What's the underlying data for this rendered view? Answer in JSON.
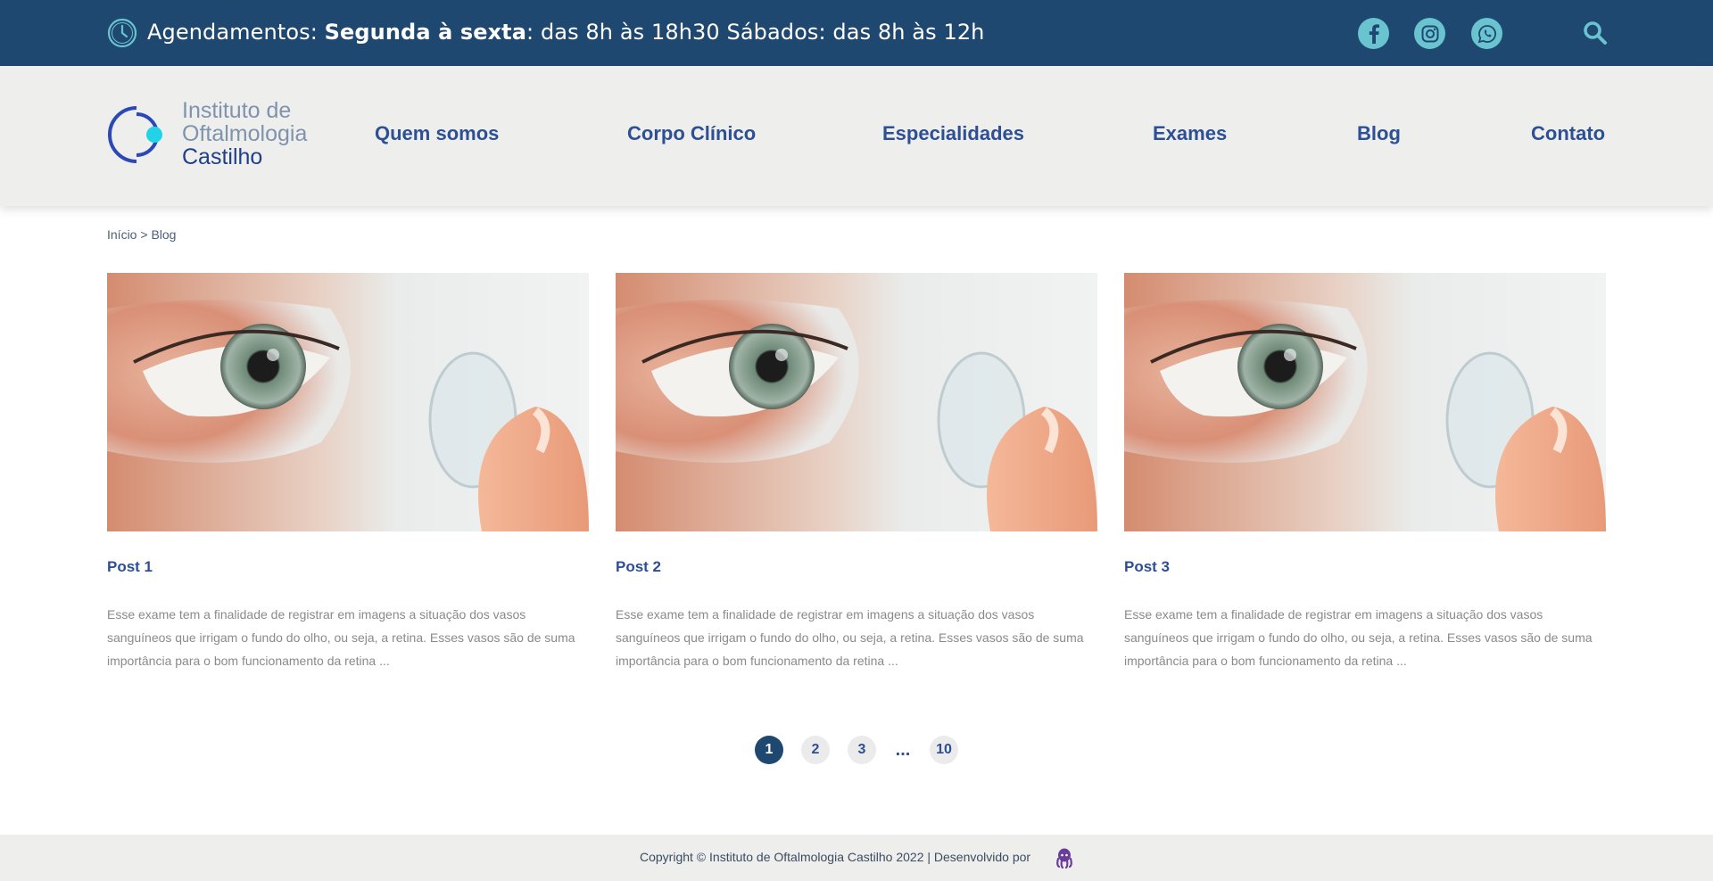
{
  "topbar": {
    "prefix": "Agendamentos: ",
    "days_bold": "Segunda à sexta",
    "hours_rest": ": das 8h às 18h30 Sábados: das 8h às 12h",
    "icons": [
      "clock-icon",
      "facebook-icon",
      "instagram-icon",
      "whatsapp-icon",
      "search-icon"
    ],
    "icon_color": "#6ac4cf",
    "bg_color": "#1f4871"
  },
  "logo": {
    "line1": "Instituto de",
    "line2": "Oftalmologia",
    "line3": "Castilho"
  },
  "nav": {
    "items": [
      "Quem somos",
      "Corpo Clínico",
      "Especialidades",
      "Exames",
      "Blog",
      "Contato"
    ],
    "color": "#2d4f96"
  },
  "breadcrumb": {
    "home": "Início",
    "sep": " > ",
    "current": "Blog"
  },
  "posts": [
    {
      "title": "Post 1",
      "excerpt": "Esse exame tem a finalidade de registrar em imagens a situação dos vasos sanguíneos que irrigam o fundo do olho, ou seja, a retina. Esses vasos são de suma importância para o bom funcionamento da retina ..."
    },
    {
      "title": "Post 2",
      "excerpt": "Esse exame tem a finalidade de registrar em imagens a situação dos vasos sanguíneos que irrigam o fundo do olho, ou seja, a retina. Esses vasos são de suma importância para o bom funcionamento da retina ..."
    },
    {
      "title": "Post 3",
      "excerpt": "Esse exame tem a finalidade de registrar em imagens a situação dos vasos sanguíneos que irrigam o fundo do olho, ou seja, a retina. Esses vasos são de suma importância para o bom funcionamento da retina ..."
    }
  ],
  "pagination": {
    "pages": [
      "1",
      "2",
      "3",
      "...",
      "10"
    ],
    "current": "1"
  },
  "footer": {
    "copyright": "Copyright © Instituto de Oftalmologia Castilho 2022 | Desenvolvido por",
    "dev_icon": "octopus-icon"
  }
}
